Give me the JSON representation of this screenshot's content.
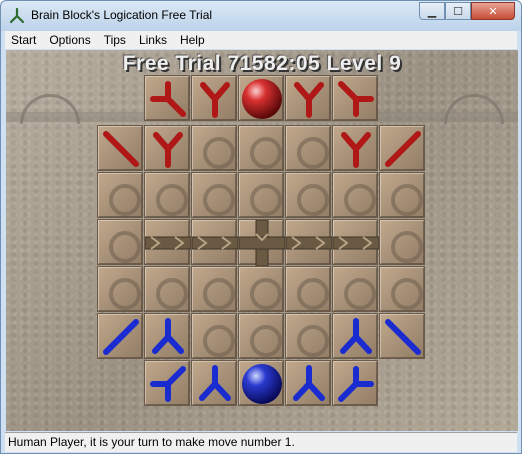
{
  "window": {
    "title": "Brain Block's Logication Free Trial"
  },
  "menu": [
    "Start",
    "Options",
    "Tips",
    "Links",
    "Help"
  ],
  "banner": "Free Trial 71582:05   Level 9",
  "status": "Human Player, it is your turn to make move number 1.",
  "colors": {
    "red": "#b01818",
    "blue": "#1a2bd0",
    "ball_red": "#d83030",
    "ball_blue": "#2a3ad0"
  },
  "board": {
    "pieces": [
      {
        "row": 0,
        "col": 1,
        "type": "red-tee-left"
      },
      {
        "row": 0,
        "col": 2,
        "type": "red-y"
      },
      {
        "row": 0,
        "col": 3,
        "type": "red-ball"
      },
      {
        "row": 0,
        "col": 4,
        "type": "red-y"
      },
      {
        "row": 0,
        "col": 5,
        "type": "red-tee-right"
      },
      {
        "row": 1,
        "col": 0,
        "type": "red-diag-down"
      },
      {
        "row": 1,
        "col": 1,
        "type": "red-y"
      },
      {
        "row": 1,
        "col": 5,
        "type": "red-y"
      },
      {
        "row": 1,
        "col": 6,
        "type": "red-diag-up"
      },
      {
        "row": 3,
        "col": 1,
        "type": "channel"
      },
      {
        "row": 3,
        "col": 2,
        "type": "channel"
      },
      {
        "row": 3,
        "col": 3,
        "type": "channel-center"
      },
      {
        "row": 3,
        "col": 4,
        "type": "channel"
      },
      {
        "row": 3,
        "col": 5,
        "type": "channel"
      },
      {
        "row": 5,
        "col": 0,
        "type": "blue-diag-up"
      },
      {
        "row": 5,
        "col": 1,
        "type": "blue-y"
      },
      {
        "row": 5,
        "col": 5,
        "type": "blue-y"
      },
      {
        "row": 5,
        "col": 6,
        "type": "blue-diag-down"
      },
      {
        "row": 6,
        "col": 1,
        "type": "blue-tee-left"
      },
      {
        "row": 6,
        "col": 2,
        "type": "blue-y"
      },
      {
        "row": 6,
        "col": 3,
        "type": "blue-ball"
      },
      {
        "row": 6,
        "col": 4,
        "type": "blue-y"
      },
      {
        "row": 6,
        "col": 5,
        "type": "blue-tee-right"
      }
    ]
  }
}
